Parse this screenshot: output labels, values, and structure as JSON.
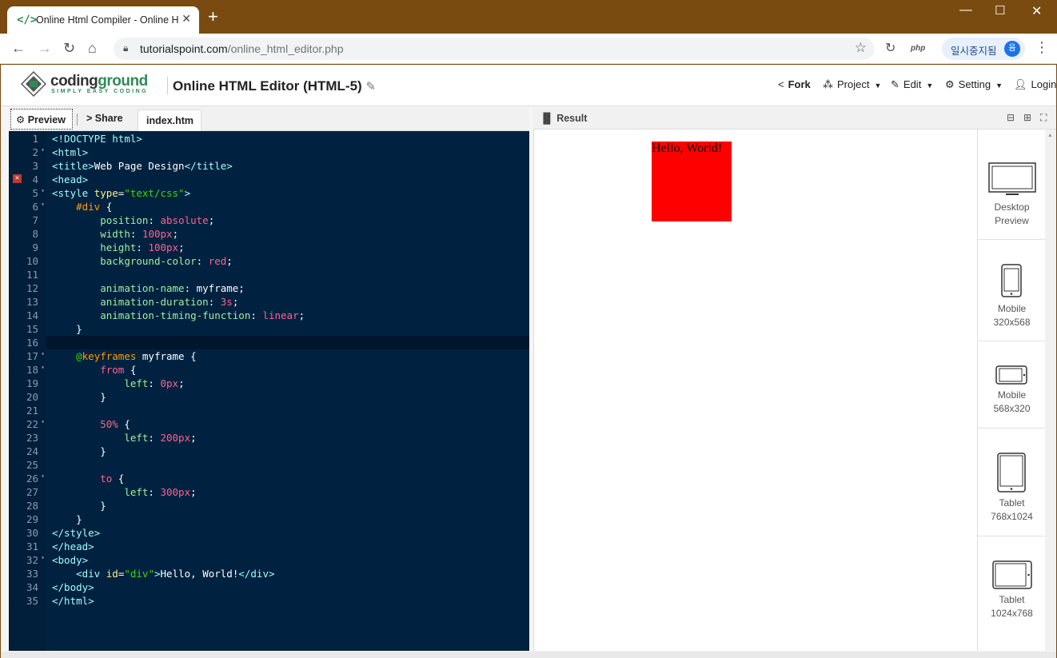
{
  "browser": {
    "tab_title": "Online Html Compiler - Online H",
    "tab_favicon": "</>",
    "url_host": "tutorialspoint.com",
    "url_path": "/online_html_editor.php",
    "extension_label": "php",
    "profile_name": "일시중지됨",
    "profile_initial": "음"
  },
  "site": {
    "logo_main": "coding",
    "logo_accent": "ground",
    "logo_tagline": "SIMPLY EASY CODING",
    "title": "Online HTML Editor (HTML-5)",
    "menu": [
      {
        "label": "Fork",
        "icon": "fork-icon"
      },
      {
        "label": "Project",
        "icon": "project-icon"
      },
      {
        "label": "Edit",
        "icon": "edit-icon"
      },
      {
        "label": "Setting",
        "icon": "gear-icon"
      },
      {
        "label": "Login",
        "icon": "user-icon"
      }
    ]
  },
  "editor": {
    "preview_label": "Preview",
    "share_label": "Share",
    "file_tab": "index.htm",
    "error_line": 4,
    "current_line": 16,
    "lines": [
      "<!DOCTYPE html>",
      "<html>",
      "<title>Web Page Design</title>",
      "<head>",
      "<style type=\"text/css\">",
      "    #div {",
      "        position: absolute;",
      "        width: 100px;",
      "        height: 100px;",
      "        background-color: red;",
      "",
      "        animation-name: myframe;",
      "        animation-duration: 3s;",
      "        animation-timing-function: linear;",
      "    }",
      "",
      "    @keyframes myframe {",
      "        from {",
      "            left: 0px;",
      "        }",
      "",
      "        50% {",
      "            left: 200px;",
      "        }",
      "",
      "        to {",
      "            left: 300px;",
      "        }",
      "    }",
      "</style>",
      "</head>",
      "<body>",
      "    <div id=\"div\">Hello, World!</div>",
      "</body>",
      "</html>"
    ],
    "fold_lines": [
      2,
      5,
      6,
      17,
      18,
      22,
      26,
      32
    ]
  },
  "result": {
    "title": "Result",
    "output_text": "Hello, World!",
    "devices": [
      {
        "name": "Desktop",
        "size": "Preview"
      },
      {
        "name": "Mobile",
        "size": "320x568"
      },
      {
        "name": "Mobile",
        "size": "568x320"
      },
      {
        "name": "Tablet",
        "size": "768x1024"
      },
      {
        "name": "Tablet",
        "size": "1024x768"
      }
    ]
  }
}
